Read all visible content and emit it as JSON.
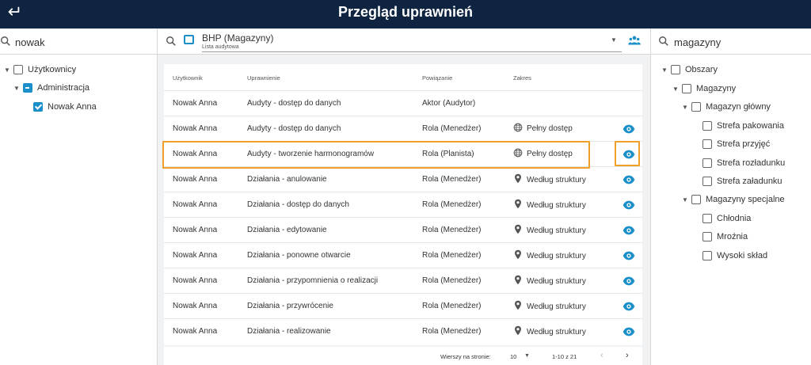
{
  "header": {
    "title": "Przegląd uprawnień",
    "back_icon": "return-arrow-icon"
  },
  "left": {
    "search_value": "nowak",
    "tree": {
      "root": "Użytkownicy",
      "group": "Administracja",
      "user": "Nowak Anna"
    }
  },
  "middle": {
    "audit_name": "BHP (Magazyny)",
    "audit_sub": "Lista audytowa",
    "columns": {
      "user": "Użytkownik",
      "permission": "Uprawnienie",
      "binding": "Powiązanie",
      "scope": "Zakres"
    },
    "rows": [
      {
        "user": "Nowak Anna",
        "permission": "Audyty - dostęp do danych",
        "binding": "Aktor (Audytor)",
        "scope": "",
        "scope_icon": ""
      },
      {
        "user": "Nowak Anna",
        "permission": "Audyty - dostęp do danych",
        "binding": "Rola (Menedżer)",
        "scope": "Pełny dostęp",
        "scope_icon": "globe-icon"
      },
      {
        "user": "Nowak Anna",
        "permission": "Audyty - tworzenie harmonogramów",
        "binding": "Rola (Planista)",
        "scope": "Pełny dostęp",
        "scope_icon": "globe-icon"
      },
      {
        "user": "Nowak Anna",
        "permission": "Działania - anulowanie",
        "binding": "Rola (Menedżer)",
        "scope": "Według struktury",
        "scope_icon": "location-pin-icon"
      },
      {
        "user": "Nowak Anna",
        "permission": "Działania - dostęp do danych",
        "binding": "Rola (Menedżer)",
        "scope": "Według struktury",
        "scope_icon": "location-pin-icon"
      },
      {
        "user": "Nowak Anna",
        "permission": "Działania - edytowanie",
        "binding": "Rola (Menedżer)",
        "scope": "Według struktury",
        "scope_icon": "location-pin-icon"
      },
      {
        "user": "Nowak Anna",
        "permission": "Działania - ponowne otwarcie",
        "binding": "Rola (Menedżer)",
        "scope": "Według struktury",
        "scope_icon": "location-pin-icon"
      },
      {
        "user": "Nowak Anna",
        "permission": "Działania - przypomnienia o realizacji",
        "binding": "Rola (Menedżer)",
        "scope": "Według struktury",
        "scope_icon": "location-pin-icon"
      },
      {
        "user": "Nowak Anna",
        "permission": "Działania - przywrócenie",
        "binding": "Rola (Menedżer)",
        "scope": "Według struktury",
        "scope_icon": "location-pin-icon"
      },
      {
        "user": "Nowak Anna",
        "permission": "Działania - realizowanie",
        "binding": "Rola (Menedżer)",
        "scope": "Według struktury",
        "scope_icon": "location-pin-icon"
      }
    ],
    "pagination": {
      "rows_label": "Wierszy na stronie:",
      "per_page": "10",
      "range": "1-10 z 21"
    }
  },
  "right": {
    "search_value": "magazyny",
    "tree": {
      "root": "Obszary",
      "magazyny": "Magazyny",
      "glowny": "Magazyn główny",
      "glowny_items": [
        "Strefa pakowania",
        "Strefa przyjęć",
        "Strefa rozładunku",
        "Strefa załadunku"
      ],
      "specjalne": "Magazyny specjalne",
      "specjalne_items": [
        "Chłodnia",
        "Mroźnia",
        "Wysoki skład"
      ]
    }
  },
  "colors": {
    "header_bg": "#0f2440",
    "accent": "#1a8fc9",
    "highlight": "#f0a02a"
  }
}
